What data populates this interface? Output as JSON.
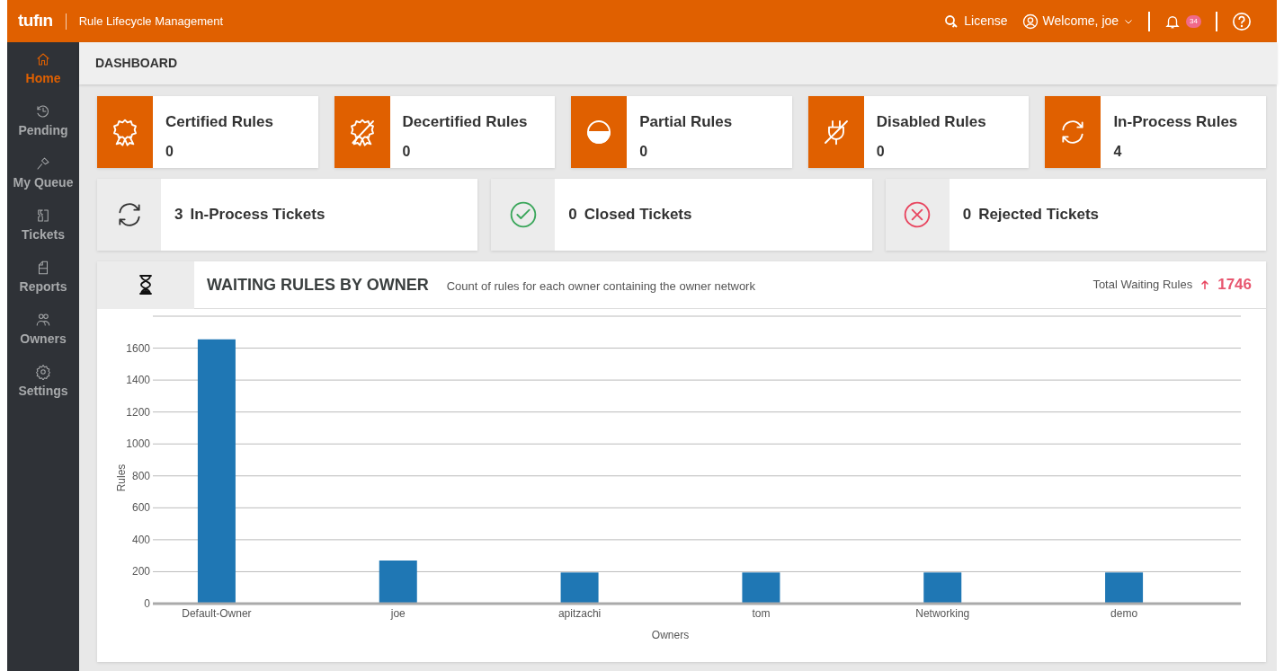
{
  "header": {
    "logo": "tufın",
    "app_title": "Rule Lifecycle Management",
    "license": "License",
    "welcome": "Welcome, joe",
    "notifications": "34"
  },
  "sidebar": {
    "items": [
      {
        "label": "Home",
        "selected": true
      },
      {
        "label": "Pending",
        "selected": false
      },
      {
        "label": "My Queue",
        "selected": false
      },
      {
        "label": "Tickets",
        "selected": false
      },
      {
        "label": "Reports",
        "selected": false
      },
      {
        "label": "Owners",
        "selected": false
      },
      {
        "label": "Settings",
        "selected": false
      }
    ]
  },
  "page_title": "DASHBOARD",
  "rule_cards": [
    {
      "label": "Certified Rules",
      "value": "0"
    },
    {
      "label": "Decertified Rules",
      "value": "0"
    },
    {
      "label": "Partial Rules",
      "value": "0"
    },
    {
      "label": "Disabled Rules",
      "value": "0"
    },
    {
      "label": "In-Process Rules",
      "value": "4"
    }
  ],
  "ticket_cards": [
    {
      "value": "3",
      "label": "In-Process Tickets"
    },
    {
      "value": "0",
      "label": "Closed Tickets"
    },
    {
      "value": "0",
      "label": "Rejected Tickets"
    }
  ],
  "waiting_panel": {
    "title": "WAITING RULES BY OWNER",
    "subtitle": "Count of rules for each owner containing the owner network",
    "total_label": "Total Waiting Rules",
    "total_value": "1746",
    "chart_data": {
      "type": "bar",
      "xlabel": "Owners",
      "ylabel": "Rules",
      "categories": [
        "Default-Owner",
        "joe",
        "apitzachi",
        "tom",
        "Networking",
        "demo"
      ],
      "series": [
        {
          "color": "#1f77b4",
          "values": [
            1655,
            270,
            195,
            195,
            195,
            195
          ]
        }
      ],
      "grid": true,
      "ylim": [
        0,
        1800
      ],
      "yticks": [
        0,
        200,
        400,
        600,
        800,
        1000,
        1200,
        1400,
        1600
      ]
    }
  }
}
